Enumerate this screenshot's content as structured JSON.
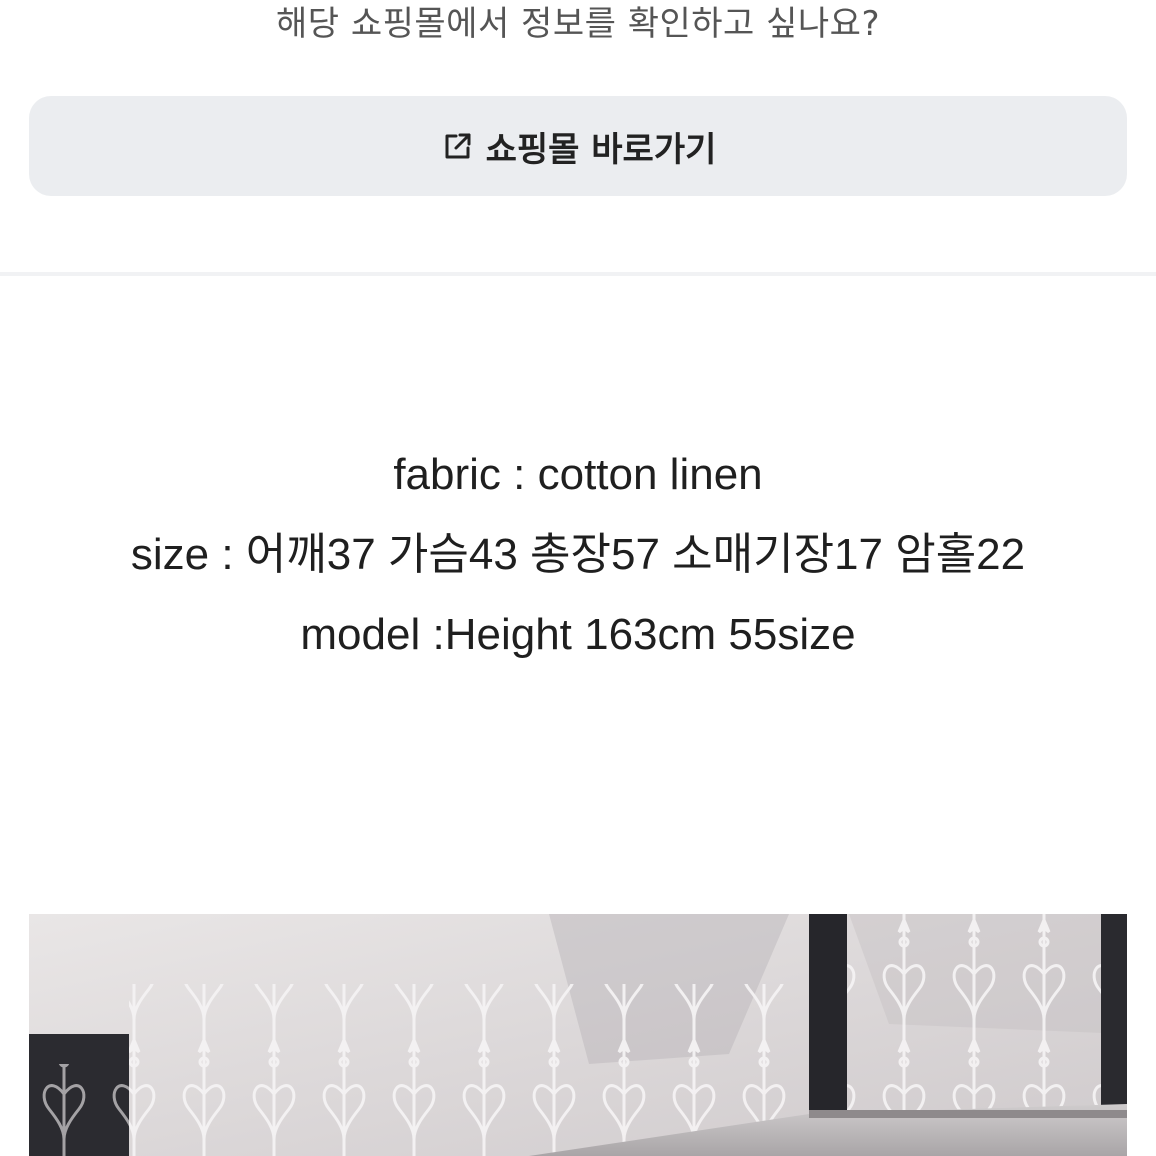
{
  "prompt": {
    "text": "해당 쇼핑몰에서 정보를 확인하고 싶나요?"
  },
  "shop_button": {
    "label": "쇼핑몰 바로가기",
    "icon": "external-link-icon"
  },
  "description": {
    "lines": [
      "fabric : cotton linen",
      "size : 어깨37 가슴43 총장57 소매기장17 암홀22",
      "model :Height  163cm 55size"
    ]
  },
  "colors": {
    "button_bg": "#ebedf0",
    "divider": "#f1f2f4",
    "prompt_text": "#555555"
  }
}
